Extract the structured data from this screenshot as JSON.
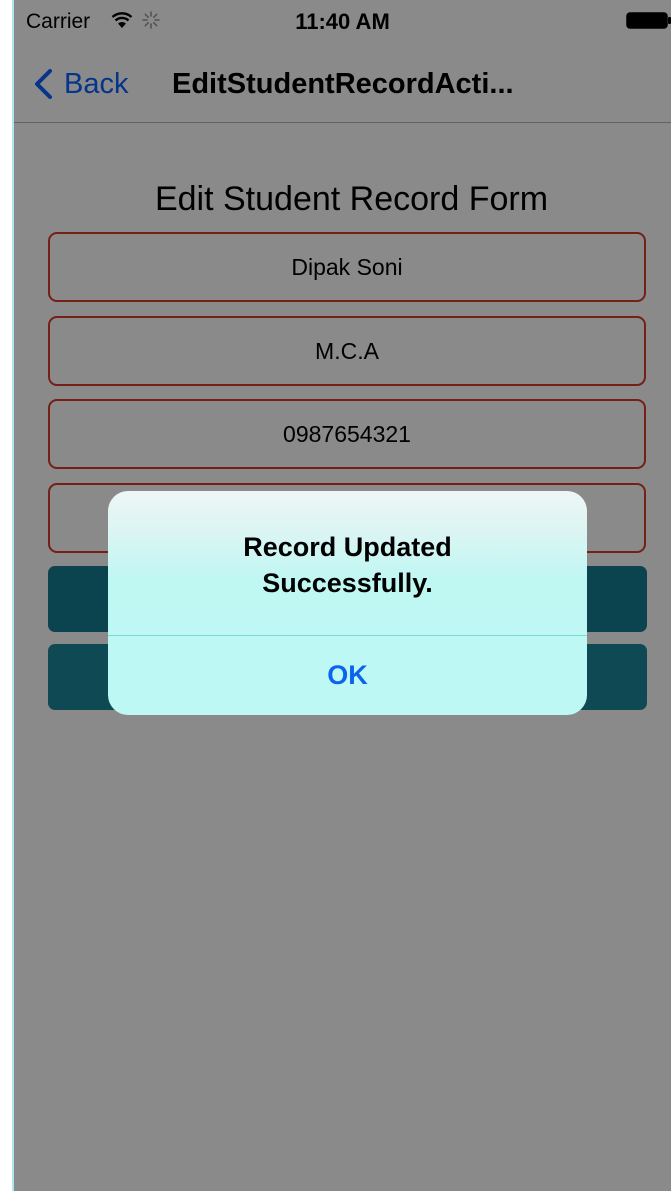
{
  "status_bar": {
    "carrier": "Carrier",
    "time": "11:40 AM"
  },
  "nav": {
    "back_label": "Back",
    "title": "EditStudentRecordActi..."
  },
  "form": {
    "title": "Edit Student Record Form",
    "fields": [
      {
        "value": "Dipak Soni"
      },
      {
        "value": "M.C.A"
      },
      {
        "value": "0987654321"
      },
      {
        "value": ""
      }
    ]
  },
  "alert": {
    "message_line1": "Record Updated",
    "message_line2": "Successfully.",
    "ok_label": "OK"
  },
  "colors": {
    "field_border": "#d83a2c",
    "button": "#1b8a9c",
    "link_blue": "#0a60ff",
    "alert_bg": "#bdf8f4"
  },
  "icons": {
    "wifi": "wifi-icon",
    "activity": "activity-spinner-icon",
    "battery": "battery-icon",
    "back": "chevron-left-icon"
  }
}
